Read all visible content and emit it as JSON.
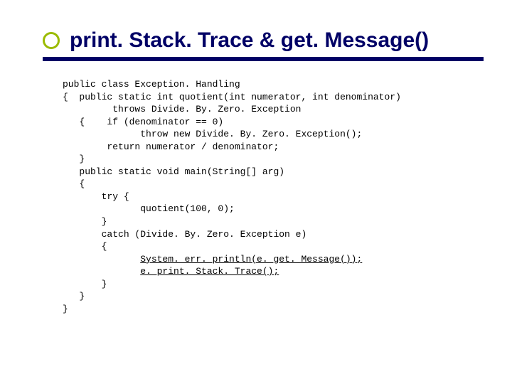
{
  "title": "print. Stack. Trace & get. Message()",
  "code": {
    "l01": "public class Exception. Handling",
    "l02": "{  public static int quotient(int numerator, int denominator)",
    "l03": "         throws Divide. By. Zero. Exception",
    "l04": "   {    if (denominator == 0)",
    "l05": "              throw new Divide. By. Zero. Exception();",
    "l06": "        return numerator / denominator;",
    "l07": "   }",
    "l08": "   public static void main(String[] arg)",
    "l09": "   {",
    "l10": "       try {",
    "l11": "              quotient(100, 0);",
    "l12": "       }",
    "l13": "       catch (Divide. By. Zero. Exception e)",
    "l14": "       {",
    "l15a": "              ",
    "l15b": "System. err. println(e. get. Message());",
    "l16a": "              ",
    "l16b": "e. print. Stack. Trace();",
    "l17": "       }",
    "l18": "   }",
    "l19": "}"
  }
}
